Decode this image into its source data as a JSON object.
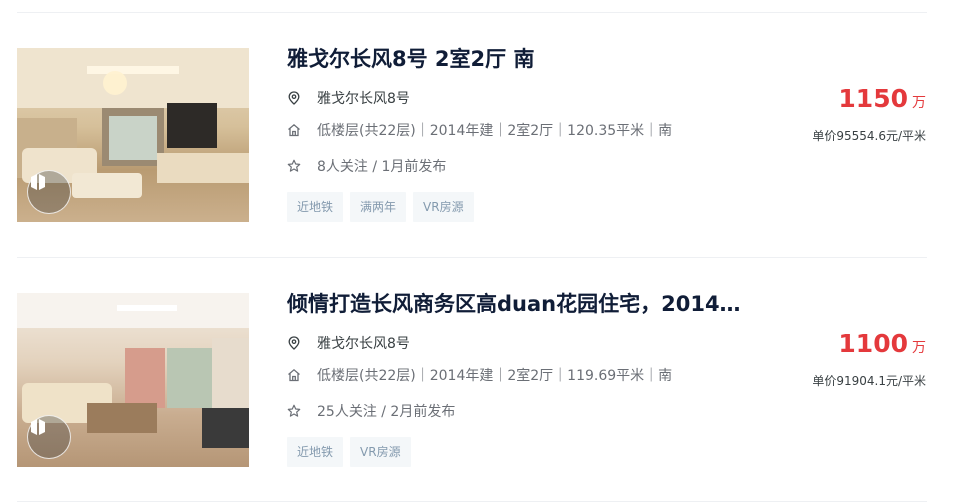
{
  "listings": [
    {
      "title": "雅戈尔长风8号 2室2厅 南",
      "community": "雅戈尔长风8号",
      "house_info": "低楼层(共22层)｜2014年建｜2室2厅｜120.35平米｜南",
      "follow_info": "8人关注 / 1月前发布",
      "tags": [
        "近地铁",
        "满两年",
        "VR房源"
      ],
      "total_price": "1150",
      "total_price_unit": "万",
      "unit_price": "单价95554.6元/平米"
    },
    {
      "title": "倾情打造长风商务区高duan花园住宅，2014…",
      "community": "雅戈尔长风8号",
      "house_info": "低楼层(共22层)｜2014年建｜2室2厅｜119.69平米｜南",
      "follow_info": "25人关注 / 2月前发布",
      "tags": [
        "近地铁",
        "VR房源"
      ],
      "total_price": "1100",
      "total_price_unit": "万",
      "unit_price": "单价91904.1元/平米"
    }
  ],
  "colors": {
    "price": "#e4393c",
    "title": "#101d37",
    "tag_bg": "#f4f7f9",
    "tag_text": "#849aae"
  },
  "icons": [
    "location-pin-icon",
    "house-icon",
    "star-icon",
    "vr-badge-icon"
  ]
}
